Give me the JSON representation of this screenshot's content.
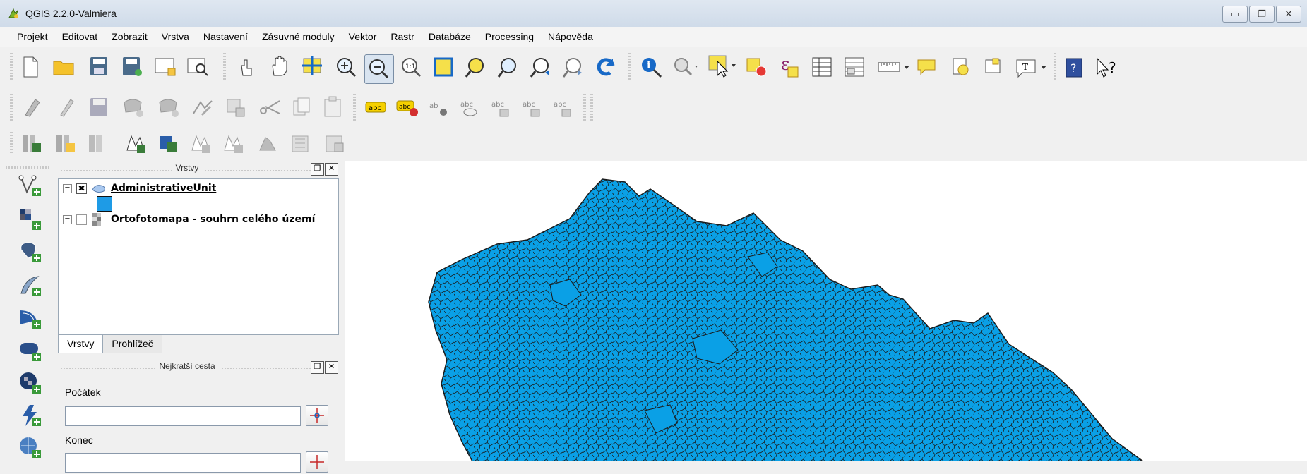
{
  "window": {
    "title": "QGIS 2.2.0-Valmiera",
    "app_icon": "qgis-logo-icon",
    "buttons": [
      {
        "name": "minimize",
        "glyph": "▭"
      },
      {
        "name": "restore",
        "glyph": "❐"
      },
      {
        "name": "close",
        "glyph": "✕"
      }
    ]
  },
  "menu": [
    "Projekt",
    "Editovat",
    "Zobrazit",
    "Vrstva",
    "Nastavení",
    "Zásuvné moduly",
    "Vektor",
    "Rastr",
    "Databáze",
    "Processing",
    "Nápověda"
  ],
  "toolbar_icons": {
    "file": [
      "new-project-icon",
      "open-project-icon",
      "save-project-icon",
      "save-as-icon",
      "new-print-composer-icon",
      "composer-manager-icon"
    ],
    "navigation": [
      "touch-zoom-icon",
      "pan-icon",
      "pan-to-selection-icon",
      "zoom-in-icon",
      "zoom-out-icon",
      "zoom-actual-icon",
      "zoom-full-icon",
      "zoom-to-selection-icon",
      "zoom-to-layer-icon",
      "zoom-last-icon",
      "zoom-next-icon",
      "refresh-icon"
    ],
    "attributes": [
      "identify-icon",
      "actions-icon",
      "select-features-icon",
      "deselect-icon",
      "expression-select-icon",
      "attribute-table-icon",
      "field-calculator-icon",
      "measure-icon",
      "map-tips-icon",
      "new-bookmark-icon",
      "show-bookmarks-icon",
      "text-annotation-icon",
      "help-icon",
      "whats-this-icon"
    ],
    "digitizing": [
      "current-edits-icon",
      "toggle-editing-icon",
      "save-edits-icon",
      "add-feature-icon",
      "move-feature-icon",
      "node-tool-icon",
      "delete-selected-icon",
      "cut-features-icon",
      "copy-features-icon",
      "paste-features-icon"
    ],
    "labels": [
      "layer-labeling-icon",
      "layer-diagram-icon",
      "pin-labels-icon",
      "show-hide-labels-icon",
      "move-label-icon",
      "rotate-label-icon",
      "change-label-icon"
    ],
    "manage": [
      "add-vector-layer-icon",
      "add-raster-layer-icon",
      "add-postgis-icon",
      "new-shapefile-icon",
      "new-spatialite-icon",
      "new-temp-layer-icon",
      "remove-layer-icon",
      "add-wms-icon",
      "add-wfs-icon",
      "add-wcs-icon"
    ]
  },
  "left_tools": [
    "add-vector-layer-icon",
    "add-raster-layer-icon",
    "add-postgis-layer-icon",
    "add-spatialite-layer-icon",
    "add-mssql-layer-icon",
    "add-oracle-layer-icon",
    "add-wms-layer-icon",
    "add-wcs-layer-icon",
    "add-wfs-layer-icon"
  ],
  "layers_panel": {
    "title": "Vrstvy",
    "layers": [
      {
        "name": "AdministrativeUnit",
        "checked": true,
        "symbol_color": "#1e9be6"
      },
      {
        "name": "Ortofotomapa - souhrn celého území",
        "checked": false
      }
    ],
    "tabs": [
      "Vrstvy",
      "Prohlížeč"
    ]
  },
  "route_panel": {
    "title": "Nejkratší cesta",
    "start_label": "Počátek",
    "end_label": "Konec",
    "start_value": "",
    "end_value": ""
  },
  "map": {
    "fill_color": "#0aa0e6",
    "stroke_color": "#1a1a1a"
  }
}
